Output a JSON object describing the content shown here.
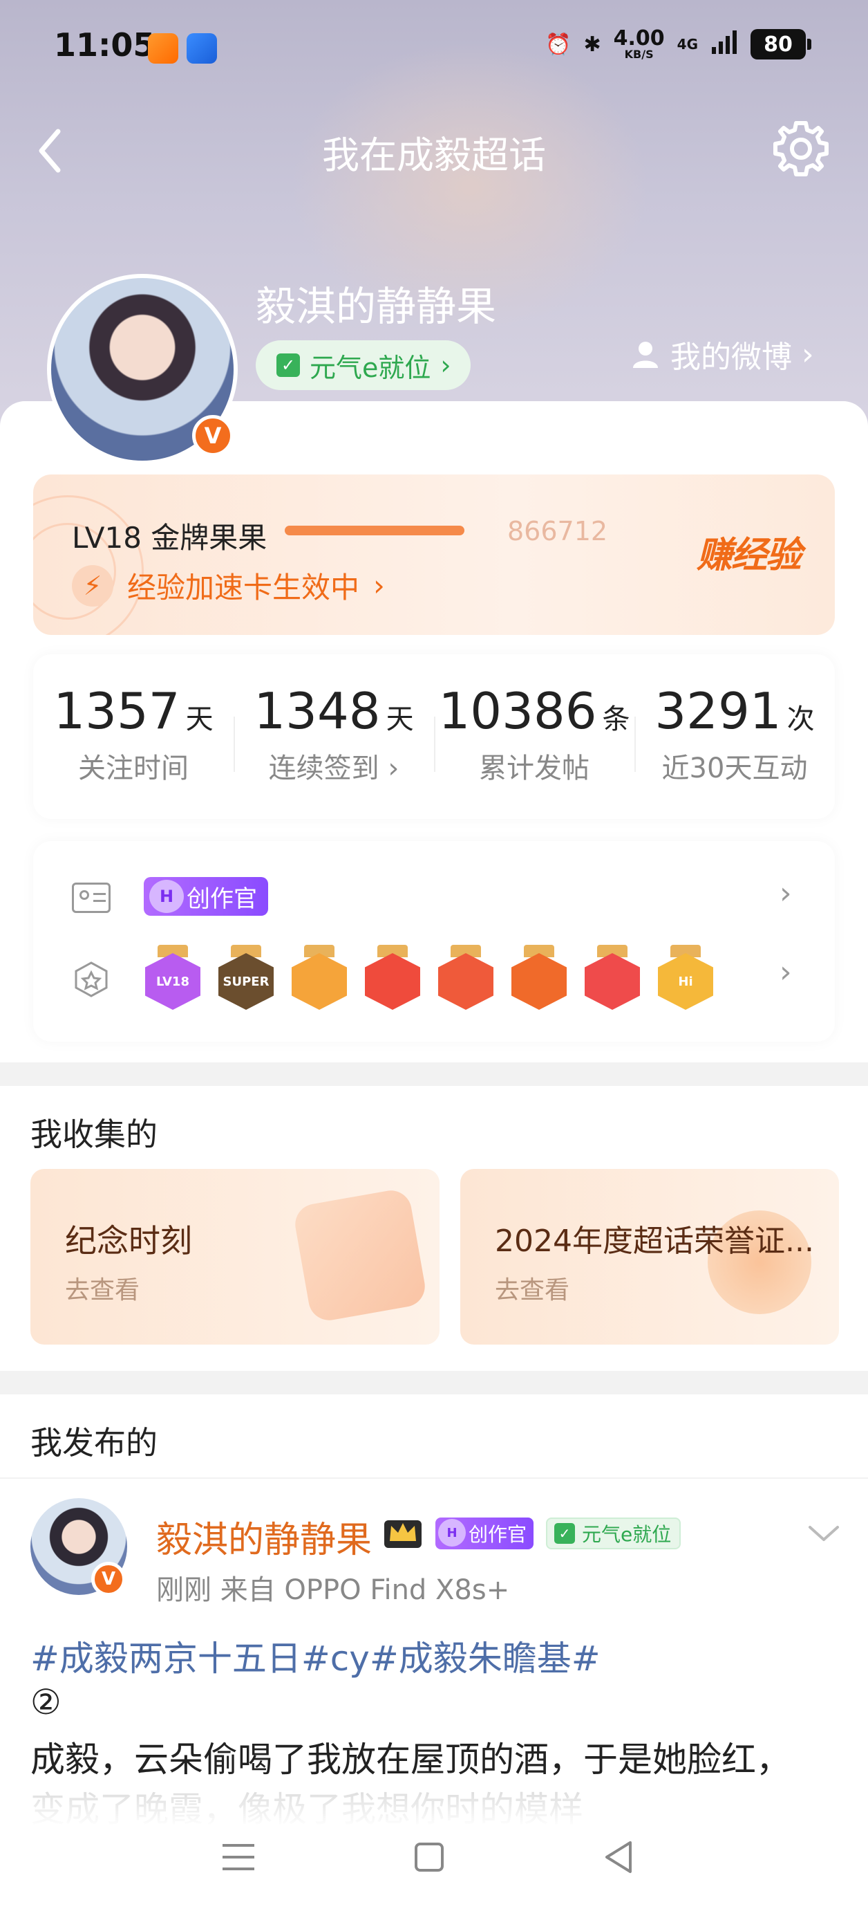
{
  "status_bar": {
    "time": "11:05",
    "net_speed": "4.00",
    "net_unit": "KB/S",
    "signal": "4G",
    "battery": "80"
  },
  "nav": {
    "title": "我在成毅超话"
  },
  "profile": {
    "username": "毅淇的静静果",
    "status_tag": "元气e就位",
    "status_tag_arrow": "›",
    "my_weibo": "我的微博",
    "verified_badge": "V"
  },
  "level": {
    "title": "LV18 金牌果果",
    "progress": 1.0,
    "exp": "866712",
    "boost": "经验加速卡生效中",
    "boost_arrow": "›",
    "earn": "赚经验"
  },
  "stats": [
    {
      "value": "1357",
      "unit": "天",
      "label": "关注时间"
    },
    {
      "value": "1348",
      "unit": "天",
      "label": "连续签到 ›"
    },
    {
      "value": "10386",
      "unit": "条",
      "label": "累计发帖"
    },
    {
      "value": "3291",
      "unit": "次",
      "label": "近30天互动"
    }
  ],
  "badges": {
    "creator": "创作官",
    "medals": [
      {
        "name": "LV18",
        "color": "#b85cf0"
      },
      {
        "name": "SUPER",
        "color": "#6b4e2e"
      },
      {
        "name": "",
        "color": "#f5a43a"
      },
      {
        "name": "",
        "color": "#ef4b3c"
      },
      {
        "name": "",
        "color": "#ef5a3a"
      },
      {
        "name": "",
        "color": "#f06a2a"
      },
      {
        "name": "",
        "color": "#ef4b4b"
      },
      {
        "name": "Hi",
        "color": "#f5b83a"
      }
    ]
  },
  "collected": {
    "title": "我收集的",
    "items": [
      {
        "title": "纪念时刻",
        "sub": "去查看"
      },
      {
        "title": "2024年度超话荣誉证...",
        "sub": "去查看"
      }
    ]
  },
  "published": {
    "title": "我发布的"
  },
  "post": {
    "author": "毅淇的静静果",
    "creator_tag": "创作官",
    "status_tag": "元气e就位",
    "meta": "刚刚   来自 OPPO Find X8s+",
    "topics": "#成毅两京十五日#cy#成毅朱瞻基#",
    "line1": "②",
    "line2": "成毅，云朵偷喝了我放在屋顶的酒，于是她脸红，",
    "line3": "变成了晚霞，像极了我想你时的模样"
  }
}
